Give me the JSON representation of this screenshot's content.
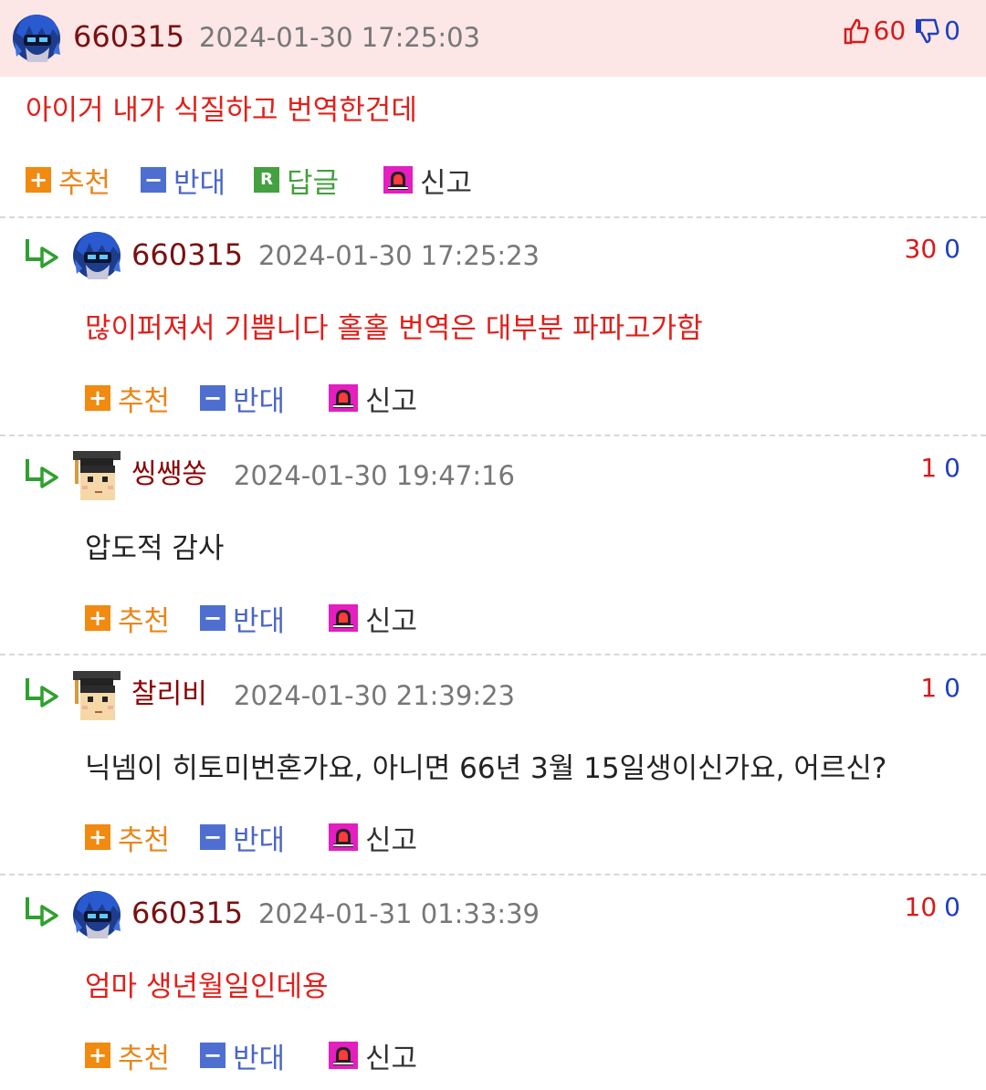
{
  "comments": [
    {
      "nick": "660315",
      "date": "2024-01-30 17:25:03",
      "up": "60",
      "down": "0",
      "text": "아이거 내가 식질하고 번역한건데",
      "actions": {
        "recommend": "추천",
        "oppose": "반대",
        "reply": "답글",
        "report": "신고"
      },
      "avatar": "blue-character-avatar-icon"
    },
    {
      "nick": "660315",
      "date": "2024-01-30 17:25:23",
      "up": "30",
      "down": "0",
      "text": "많이퍼져서 기쁩니다 홀홀 번역은 대부분 파파고가함",
      "actions": {
        "recommend": "추천",
        "oppose": "반대",
        "report": "신고"
      },
      "avatar": "blue-character-avatar-icon"
    },
    {
      "nick": "씽쌩쏭",
      "date": "2024-01-30 19:47:16",
      "up": "1",
      "down": "0",
      "text": "압도적 감사",
      "actions": {
        "recommend": "추천",
        "oppose": "반대",
        "report": "신고"
      },
      "avatar": "graduate-avatar-icon"
    },
    {
      "nick": "찰리비",
      "date": "2024-01-30 21:39:23",
      "up": "1",
      "down": "0",
      "text": "닉넴이 히토미번혼가요, 아니면 66년 3월 15일생이신가요, 어르신?",
      "actions": {
        "recommend": "추천",
        "oppose": "반대",
        "report": "신고"
      },
      "avatar": "graduate-avatar-icon"
    },
    {
      "nick": "660315",
      "date": "2024-01-31 01:33:39",
      "up": "10",
      "down": "0",
      "text": "엄마 생년월일인데용",
      "actions": {
        "recommend": "추천",
        "oppose": "반대",
        "report": "신고"
      },
      "avatar": "blue-character-avatar-icon"
    }
  ],
  "colors": {
    "top_comment_bg": "#fde6e6",
    "author_text": "#e0201b",
    "up_vote": "#d71a1a",
    "down_vote": "#1f3fbf",
    "recommend": "#f08a10",
    "oppose": "#4f6fd0",
    "reply": "#44a040",
    "report": "#e41ec0"
  }
}
